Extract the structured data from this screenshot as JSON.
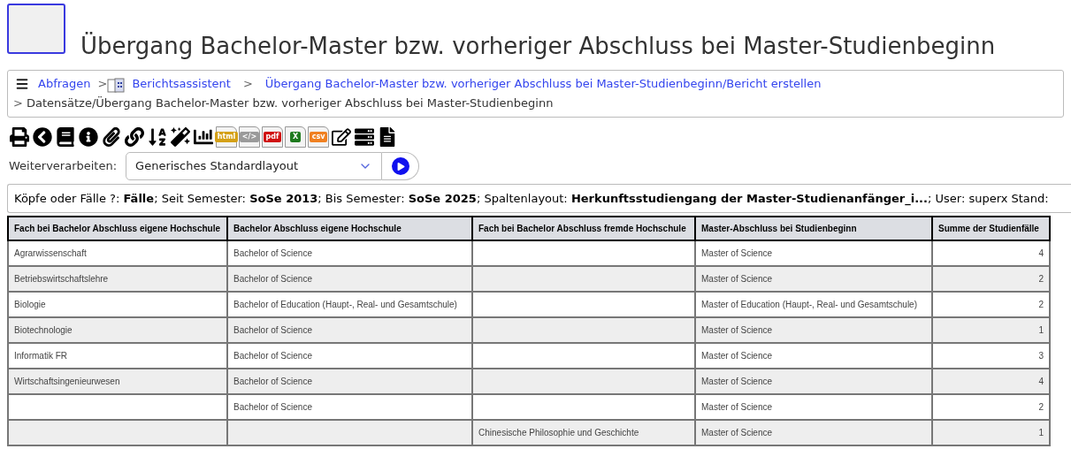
{
  "title": "Übergang Bachelor-Master bzw. vorheriger Abschluss bei Master-Studienbeginn",
  "breadcrumb": [
    {
      "label": "Abfragen",
      "kind": "link"
    },
    {
      "separator": ">",
      "label": "Berichtsassistent",
      "kind": "link"
    },
    {
      "separator": ">",
      "label": "Übergang Bachelor-Master bzw. vorheriger Abschluss bei Master-Studienbeginn/Bericht erstellen",
      "kind": "link"
    },
    {
      "separator": ">",
      "label": "Datensätze/Übergang Bachelor-Master bzw. vorheriger Abschluss bei Master-Studienbeginn",
      "kind": "text"
    }
  ],
  "toolbar": [
    {
      "kind": "print"
    },
    {
      "kind": "back"
    },
    {
      "kind": "book"
    },
    {
      "kind": "info"
    },
    {
      "kind": "clip"
    },
    {
      "kind": "link"
    },
    {
      "kind": "sort"
    },
    {
      "kind": "wand"
    },
    {
      "kind": "chart"
    },
    {
      "kind": "file",
      "label": "html",
      "color": "#d4a017"
    },
    {
      "kind": "file",
      "label": "</>",
      "color": "#9a9a9a"
    },
    {
      "kind": "file",
      "label": "pdf",
      "color": "#d01010"
    },
    {
      "kind": "file",
      "label": "X",
      "color": "#1d7a1d"
    },
    {
      "kind": "file",
      "label": "csv",
      "color": "#f08020"
    },
    {
      "kind": "edit"
    },
    {
      "kind": "server"
    },
    {
      "kind": "doc"
    }
  ],
  "export": {
    "label": "Weiterverarbeiten:",
    "value": "Generisches Standardlayout"
  },
  "filter_summary": "Köpfe oder Fälle ?:  **Fälle**; Seit Semester:  **SoSe 2013**; Bis Semester:  **SoSe 2025**; Spaltenlayout:  **Herkunftsstudiengang der Master-Studienanfänger_i...**; User: superx Stand:",
  "table": {
    "columns": [
      "Fach bei Bachelor Abschluss eigene Hochschule",
      "Bachelor Abschluss eigene Hochschule",
      "Fach bei Bachelor Abschluss fremde Hochschule",
      "Master-Abschluss bei Studienbeginn",
      "Summe der Studienfälle"
    ],
    "rows": [
      [
        "Agrarwissenschaft",
        "Bachelor of Science",
        "",
        "Master of Science",
        "4"
      ],
      [
        "Betriebswirtschaftslehre",
        "Bachelor of Science",
        "",
        "Master of Science",
        "2"
      ],
      [
        "Biologie",
        "Bachelor of Education (Haupt-, Real- und Gesamtschule)",
        "",
        "Master of Education (Haupt-, Real- und Gesamtschule)",
        "2"
      ],
      [
        "Biotechnologie",
        "Bachelor of Science",
        "",
        "Master of Science",
        "1"
      ],
      [
        "Informatik FR",
        "Bachelor of Science",
        "",
        "Master of Science",
        "3"
      ],
      [
        "Wirtschaftsingenieurwesen",
        "Bachelor of Science",
        "",
        "Master of Science",
        "4"
      ],
      [
        "",
        "Bachelor of Science",
        "",
        "Master of Science",
        "2"
      ],
      [
        "",
        "",
        "Chinesische Philosophie und Geschichte",
        "Master of Science",
        "1"
      ]
    ]
  }
}
